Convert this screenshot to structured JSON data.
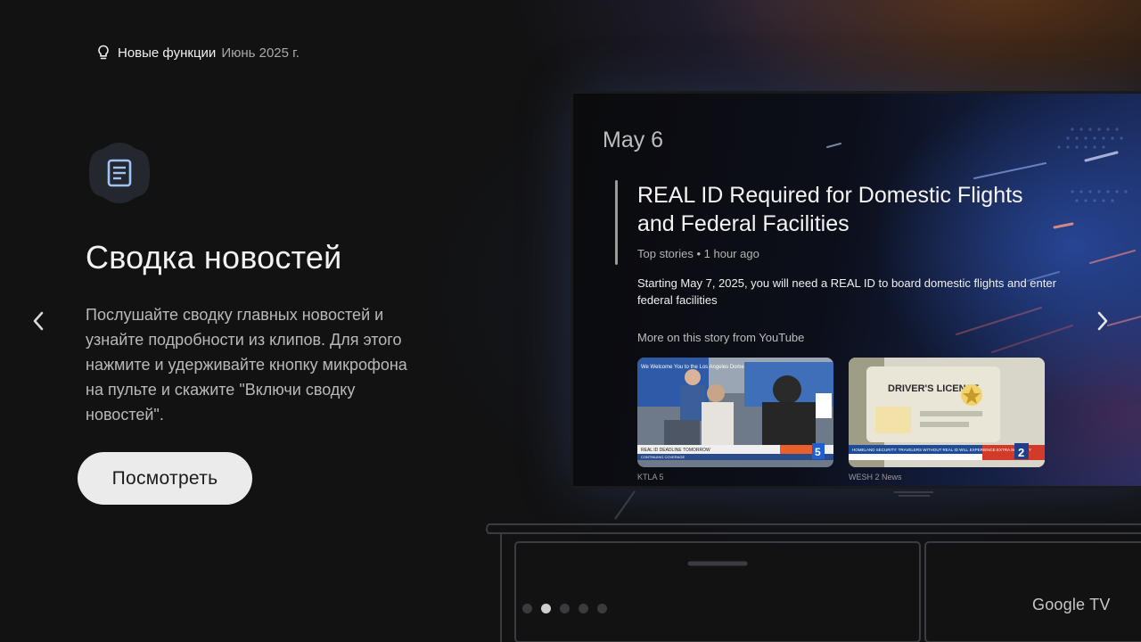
{
  "header": {
    "icon": "lightbulb-icon",
    "title": "Новые функции",
    "date": "Июнь 2025 г."
  },
  "feature": {
    "icon": "document-icon",
    "title": "Сводка новостей",
    "description": "Послушайте сводку главных новостей и\nузнайте подробности из клипов. Для этого\nнажмите и удерживайте кнопку микрофона\nна пульте и скажите \"Включи сводку\nновостей\".",
    "button_label": "Посмотреть"
  },
  "tv": {
    "date": "May 6",
    "story_title": "REAL ID Required for Domestic Flights and Federal Facilities",
    "story_meta": "Top stories • 1 hour ago",
    "story_summary": "Starting May 7, 2025, you will need a REAL ID to board domestic flights and enter federal facilities",
    "more_label": "More on this story from YouTube",
    "videos": [
      {
        "source": "KTLA 5",
        "ticker": "REAL ID DEADLINE TOMORROW",
        "ticker_sub": "CONTINUING COVERAGE",
        "channel_badge": "5",
        "overlay_text": "We Welcome You to the Los Angeles Domestic Valid Identification"
      },
      {
        "source": "WESH 2 News",
        "ticker": "HOMELAND SECURITY: TRAVELERS WITHOUT REAL ID WILL EXPERIENCE EXTRA SCRUTINY",
        "channel_badge": "2",
        "overlay_text": "DRIVER'S LICENSE"
      }
    ]
  },
  "pager": {
    "count": 5,
    "active_index": 1
  },
  "brand": "Google TV",
  "colors": {
    "background": "#121213",
    "button_bg": "#ecebeb",
    "accent_blue": "#8ab4f8"
  }
}
